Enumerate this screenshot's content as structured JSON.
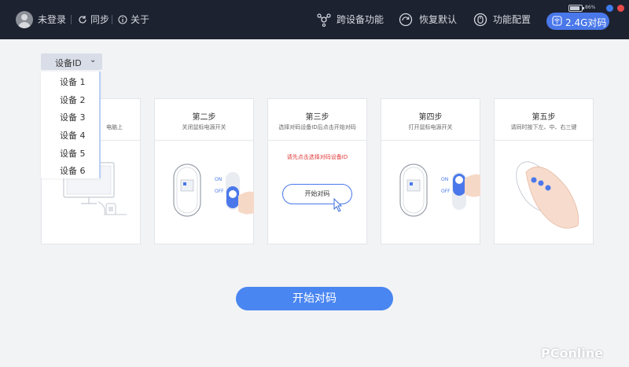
{
  "topbar": {
    "login_label": "未登录",
    "sync_label": "同步",
    "about_label": "关于",
    "cross_device_label": "跨设备功能",
    "restore_default_label": "恢复默认",
    "function_config_label": "功能配置",
    "pairing_label": "2.4G对码",
    "battery_percent": "86%",
    "battery_level": 0.86,
    "window_dot_colors": [
      "#3d7cf0",
      "#e84b4b"
    ]
  },
  "dropdown": {
    "selected": "设备ID",
    "options": [
      "设备 1",
      "设备 2",
      "设备 3",
      "设备 4",
      "设备 5",
      "设备 6"
    ]
  },
  "steps": [
    {
      "title": "",
      "desc": "电脑上"
    },
    {
      "title": "第二步",
      "desc": "关闭鼠标电源开关",
      "on_label": "ON",
      "off_label": "OFF"
    },
    {
      "title": "第三步",
      "desc": "选择对码设备ID后点击开始对码",
      "warning": "请先点击选择对码设备ID",
      "button": "开始对码"
    },
    {
      "title": "第四步",
      "desc": "打开鼠标电源开关",
      "on_label": "ON",
      "off_label": "OFF"
    },
    {
      "title": "第五步",
      "desc": "请同时按下左、中、右三键"
    }
  ],
  "main_button": "开始对码",
  "watermark": "PConline",
  "colors": {
    "accent": "#4a86f1",
    "topbar": "#1d2230",
    "warning": "#e23b3b"
  }
}
